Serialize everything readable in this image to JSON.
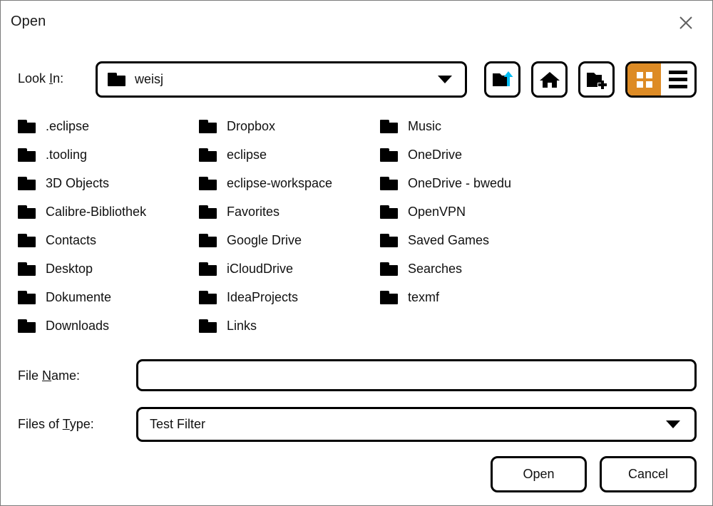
{
  "window": {
    "title": "Open",
    "close_icon": "close-icon"
  },
  "lookin": {
    "label_pre": "Look ",
    "label_mnemonic": "I",
    "label_post": "n:",
    "value": "weisj",
    "folder_icon": "folder-icon",
    "caret_icon": "chevron-down-icon"
  },
  "toolbar": {
    "up_button": "folder-up-icon",
    "home_button": "home-icon",
    "new_folder_button": "new-folder-icon",
    "view_grid": "grid-view-icon",
    "view_list": "list-view-icon",
    "selected_view": "grid",
    "accent_color": "#dd8b25",
    "arrow_color": "#00bcf2"
  },
  "files": {
    "columns": [
      [
        {
          "name": ".eclipse",
          "type": "folder"
        },
        {
          "name": ".tooling",
          "type": "folder"
        },
        {
          "name": "3D Objects",
          "type": "folder"
        },
        {
          "name": "Calibre-Bibliothek",
          "type": "folder"
        },
        {
          "name": "Contacts",
          "type": "folder"
        },
        {
          "name": "Desktop",
          "type": "folder"
        },
        {
          "name": "Dokumente",
          "type": "folder"
        },
        {
          "name": "Downloads",
          "type": "folder"
        }
      ],
      [
        {
          "name": "Dropbox",
          "type": "folder"
        },
        {
          "name": "eclipse",
          "type": "folder"
        },
        {
          "name": "eclipse-workspace",
          "type": "folder"
        },
        {
          "name": "Favorites",
          "type": "folder"
        },
        {
          "name": "Google Drive",
          "type": "folder"
        },
        {
          "name": "iCloudDrive",
          "type": "folder"
        },
        {
          "name": "IdeaProjects",
          "type": "folder"
        },
        {
          "name": "Links",
          "type": "folder"
        }
      ],
      [
        {
          "name": "Music",
          "type": "folder"
        },
        {
          "name": "OneDrive",
          "type": "folder"
        },
        {
          "name": "OneDrive - bwedu",
          "type": "folder"
        },
        {
          "name": "OpenVPN",
          "type": "folder"
        },
        {
          "name": "Saved Games",
          "type": "folder"
        },
        {
          "name": "Searches",
          "type": "folder"
        },
        {
          "name": "texmf",
          "type": "folder"
        }
      ]
    ]
  },
  "filename": {
    "label_pre": "File ",
    "label_mnemonic": "N",
    "label_post": "ame:",
    "value": "",
    "placeholder": ""
  },
  "filetype": {
    "label_pre": "Files of ",
    "label_mnemonic": "T",
    "label_post": "ype:",
    "value": "Test Filter",
    "caret_icon": "chevron-down-icon"
  },
  "actions": {
    "open_label": "Open",
    "cancel_label": "Cancel"
  }
}
